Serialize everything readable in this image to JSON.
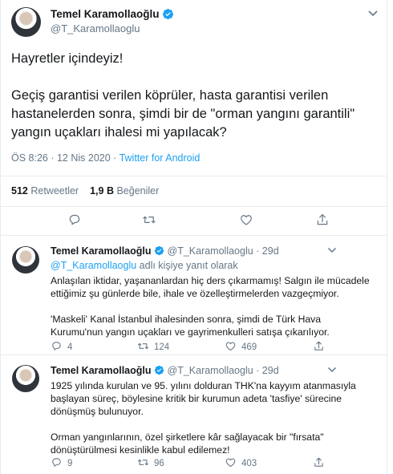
{
  "tweet": {
    "author_name": "Temel Karamollaoğlu",
    "author_handle": "@T_Karamollaoglu",
    "text_lines": [
      "Hayretler içindeyiz!",
      "Geçiş garantisi verilen köprüler, hasta garantisi verilen hastanelerden sonra, şimdi bir de \"orman yangını garantili\" yangın uçakları ihalesi mi yapılacak?"
    ],
    "time": "ÖS 8:26 · 12 Nis 2020 · ",
    "source": "Twitter for Android",
    "retweets_count": "512",
    "retweets_label": "Retweetler",
    "likes_count": "1,9 B",
    "likes_label": "Beğeniler"
  },
  "replies": [
    {
      "author_name": "Temel Karamollaoğlu",
      "author_handle": "@T_Karamollaoglu",
      "separator": " · ",
      "age": "29d",
      "replying_handle": "@T_Karamollaoglu",
      "replying_suffix": " adlı kişiye yanıt olarak",
      "paragraphs": [
        "Anlaşılan iktidar, yaşananlardan hiç ders çıkarmamış! Salgın ile mücadele ettiğimiz şu günlerde bile, ihale ve özelleştirmelerden vazgeçmiyor.",
        "'Maskeli' Kanal İstanbul ihalesinden sonra, şimdi de Türk Hava Kurumu'nun yangın uçakları ve gayrimenkulleri satışa çıkarılıyor."
      ],
      "reply_count": "4",
      "retweet_count": "124",
      "like_count": "469"
    },
    {
      "author_name": "Temel Karamollaoğlu",
      "author_handle": "@T_Karamollaoglu",
      "separator": " · ",
      "age": "29d",
      "paragraphs": [
        "1925 yılında kurulan ve 95. yılını dolduran THK'na kayyım atanmasıyla başlayan süreç, böylesine kritik bir kurumun adeta 'tasfiye' sürecine dönüşmüş bulunuyor.",
        "Orman yangınlarının, özel şirketlere kâr sağlayacak bir \"fırsata\" dönüştürülmesi kesinlikle kabul edilemez!"
      ],
      "reply_count": "9",
      "retweet_count": "96",
      "like_count": "403"
    }
  ],
  "colors": {
    "accent": "#1da1f2",
    "secondary_text": "#657786",
    "divider": "#e6ecf0",
    "text": "#14171a"
  },
  "icons": {
    "verified": "verified-badge-icon",
    "caret": "chevron-down-icon",
    "reply": "reply-bubble-icon",
    "retweet": "retweet-icon",
    "like": "heart-icon",
    "share": "share-icon"
  }
}
